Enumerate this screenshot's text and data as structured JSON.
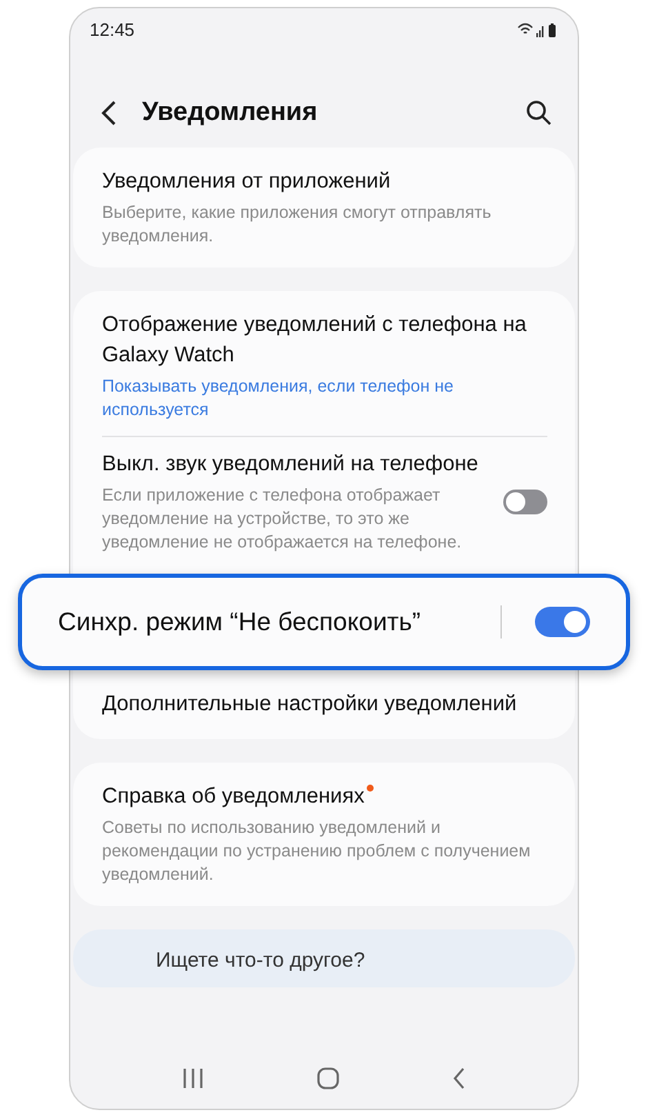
{
  "status_bar": {
    "time": "12:45"
  },
  "header": {
    "title": "Уведомления"
  },
  "cards": [
    {
      "items": [
        {
          "kind": "link",
          "title": "Уведомления от приложений",
          "subtitle": "Выберите, какие приложения смогут отправлять уведомления.",
          "subtitle_accent": false
        }
      ]
    },
    {
      "items": [
        {
          "kind": "link",
          "title": "Отображение уведомлений с телефона на Galaxy Watch",
          "subtitle": "Показывать уведомления, если телефон не используется",
          "subtitle_accent": true
        },
        {
          "kind": "toggle",
          "title": "Выкл. звук уведомлений на телефоне",
          "subtitle": "Если приложение с телефона отображает уведомление на устройстве, то это же уведомление не отображается на телефоне.",
          "on": false
        },
        {
          "kind": "highlighted_toggle",
          "title": "Синхр. режим “Не беспокоить”",
          "on": true
        },
        {
          "kind": "link",
          "title": "Дополнительные настройки уведомлений"
        }
      ]
    },
    {
      "items": [
        {
          "kind": "link",
          "title": "Справка об уведомлениях",
          "new_dot": true,
          "subtitle": "Советы по использованию уведомлений и рекомендации по устранению проблем с получением уведомлений.",
          "subtitle_accent": false
        }
      ]
    }
  ],
  "footer_card": {
    "title": "Ищете что-то другое?"
  }
}
